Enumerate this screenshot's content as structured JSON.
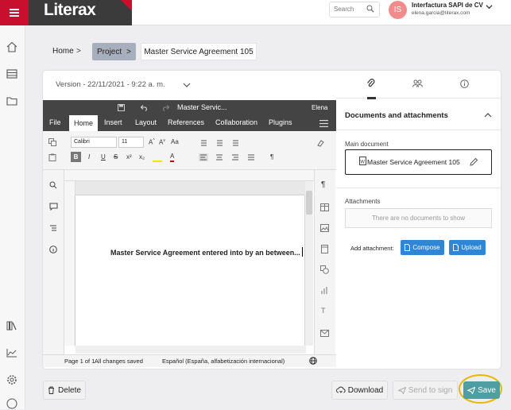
{
  "app": {
    "brand": "Literax"
  },
  "header": {
    "search_placeholder": "Search",
    "avatar_initials": "IS",
    "account_name": "Interfactura SAPI de CV",
    "account_email": "elena.garcia@literax.com"
  },
  "sidebar": {
    "items": [
      {
        "icon": "home-icon"
      },
      {
        "icon": "list-icon"
      },
      {
        "icon": "folder-icon"
      },
      {
        "icon": "library-icon"
      },
      {
        "icon": "chart-icon"
      },
      {
        "icon": "gear-icon"
      },
      {
        "icon": "help-icon"
      }
    ]
  },
  "breadcrumb": {
    "home": "Home",
    "project": "Project",
    "document": "Master Service Agreement 105",
    "sep": ">"
  },
  "version": {
    "label": "Version - 22/11/2021 - 9:22 a. m."
  },
  "editor": {
    "doc_title": "Master Servic...",
    "user": "Elena",
    "tabs": [
      "File",
      "Home",
      "Insert",
      "Layout",
      "References",
      "Collaboration",
      "Plugins"
    ],
    "active_tab": "Home",
    "font_name": "Calibri",
    "font_size": "11",
    "body_text": "Master Service Agreement entered into by an between...",
    "status_page": "Page 1 of 1",
    "status_saved": "All changes saved",
    "status_lang": "Español (España, alfabetización internacional)"
  },
  "panel": {
    "heading": "Documents and attachments",
    "main_label": "Main document",
    "main_doc": "Master Service Agreement 105",
    "attachments_label": "Attachments",
    "attachments_empty": "There are no documents to show",
    "add_label": "Add attachment:",
    "compose": "Compose",
    "upload": "Upload"
  },
  "footer": {
    "delete": "Delete",
    "download": "Download",
    "send": "Send to sign",
    "save": "Save"
  },
  "colors": {
    "brand_red": "#c8102e",
    "primary_blue": "#2f86d6",
    "save_teal": "#4f9fa2",
    "highlight": "#e6b800"
  }
}
